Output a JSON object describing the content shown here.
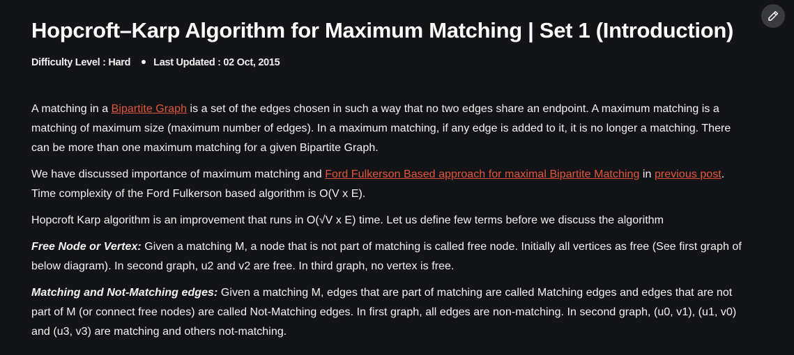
{
  "header": {
    "title": "Hopcroft–Karp Algorithm for Maximum Matching | Set 1 (Introduction)",
    "difficulty": "Difficulty Level : Hard",
    "updated": "Last Updated : 02 Oct, 2015",
    "edit_icon": "pencil-icon"
  },
  "paragraphs": {
    "p1": {
      "t1": "A matching in a ",
      "link": "Bipartite Graph",
      "t2": " is a set of the edges chosen in such a way that no two edges share an endpoint. A maximum matching is a matching of maximum size (maximum number of edges). In a maximum matching, if any edge is added to it, it is no longer a matching. There can be more than one maximum matching for a given Bipartite Graph."
    },
    "p2": {
      "t1": "We have discussed importance of maximum matching and ",
      "link1": "Ford Fulkerson Based approach for maximal Bipartite Matching",
      "t2": " in ",
      "link2": "previous post",
      "t3": ". Time complexity of the Ford Fulkerson based algorithm is O(V x E)."
    },
    "p3": {
      "t1": "Hopcroft Karp algorithm is an improvement that runs in O(√V x E) time. Let us define few terms before we discuss the algorithm"
    },
    "p4": {
      "term": "Free Node or Vertex:",
      "t1": " Given a matching M, a node that is not part of matching is called free node. Initially all vertices as free (See first graph of below diagram). In second graph, u2 and v2 are free. In third graph, no vertex is free."
    },
    "p5": {
      "term": "Matching and Not-Matching edges:",
      "t1": " Given a matching M, edges that are part of matching are called Matching edges and edges that are not part of M (or connect free nodes) are called Not-Matching edges. In first graph, all edges are non-matching. In second graph, (u0, v1), (u1, v0) and (u3, v3) are matching and others not-matching."
    }
  },
  "colors": {
    "background": "#131417",
    "link": "#e2553b",
    "text": "#f3f3f3"
  }
}
